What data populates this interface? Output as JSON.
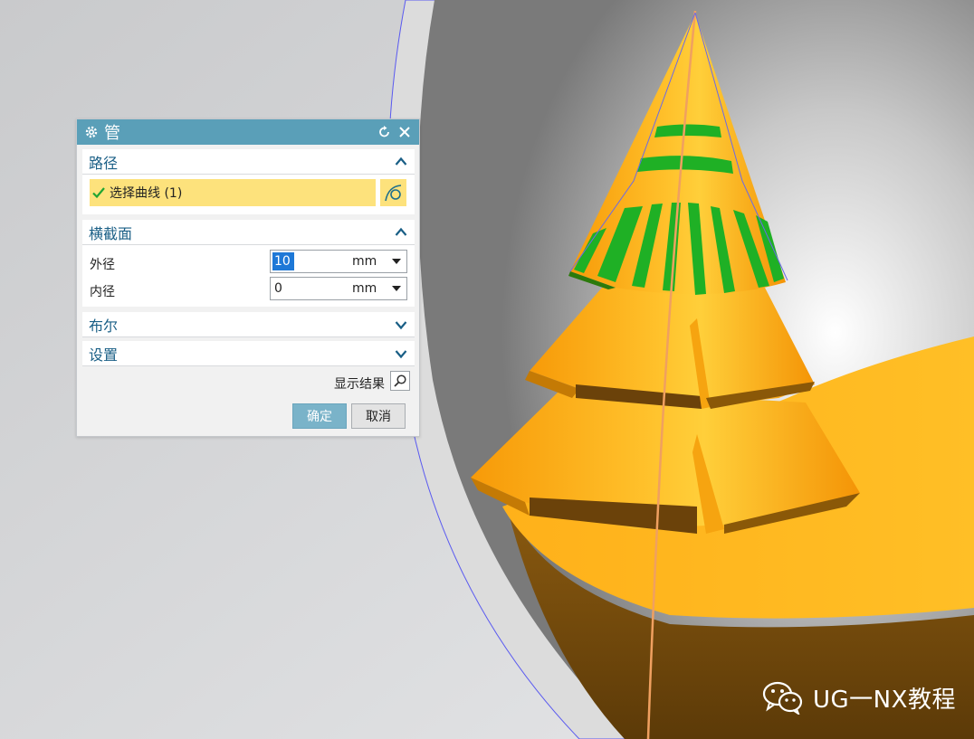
{
  "dialog": {
    "title": "管",
    "sections": {
      "path": {
        "label": "路径",
        "selection_text": "选择曲线 (1)"
      },
      "cross_section": {
        "label": "横截面",
        "outer_diameter": {
          "label": "外径",
          "value": "10",
          "unit": "mm"
        },
        "inner_diameter": {
          "label": "内径",
          "value": "0",
          "unit": "mm"
        }
      },
      "boolean": {
        "label": "布尔"
      },
      "settings": {
        "label": "设置"
      }
    },
    "show_result_label": "显示结果",
    "ok_label": "确定",
    "cancel_label": "取消"
  },
  "watermark": {
    "text": "UG一NX教程"
  },
  "colors": {
    "title_bar": "#5a9fb8",
    "section_text": "#1a5f86",
    "selection_highlight": "#fde27c",
    "model_yellow": "#ffb21a",
    "model_green": "#1fb025",
    "path_curve": "#f0a060"
  }
}
